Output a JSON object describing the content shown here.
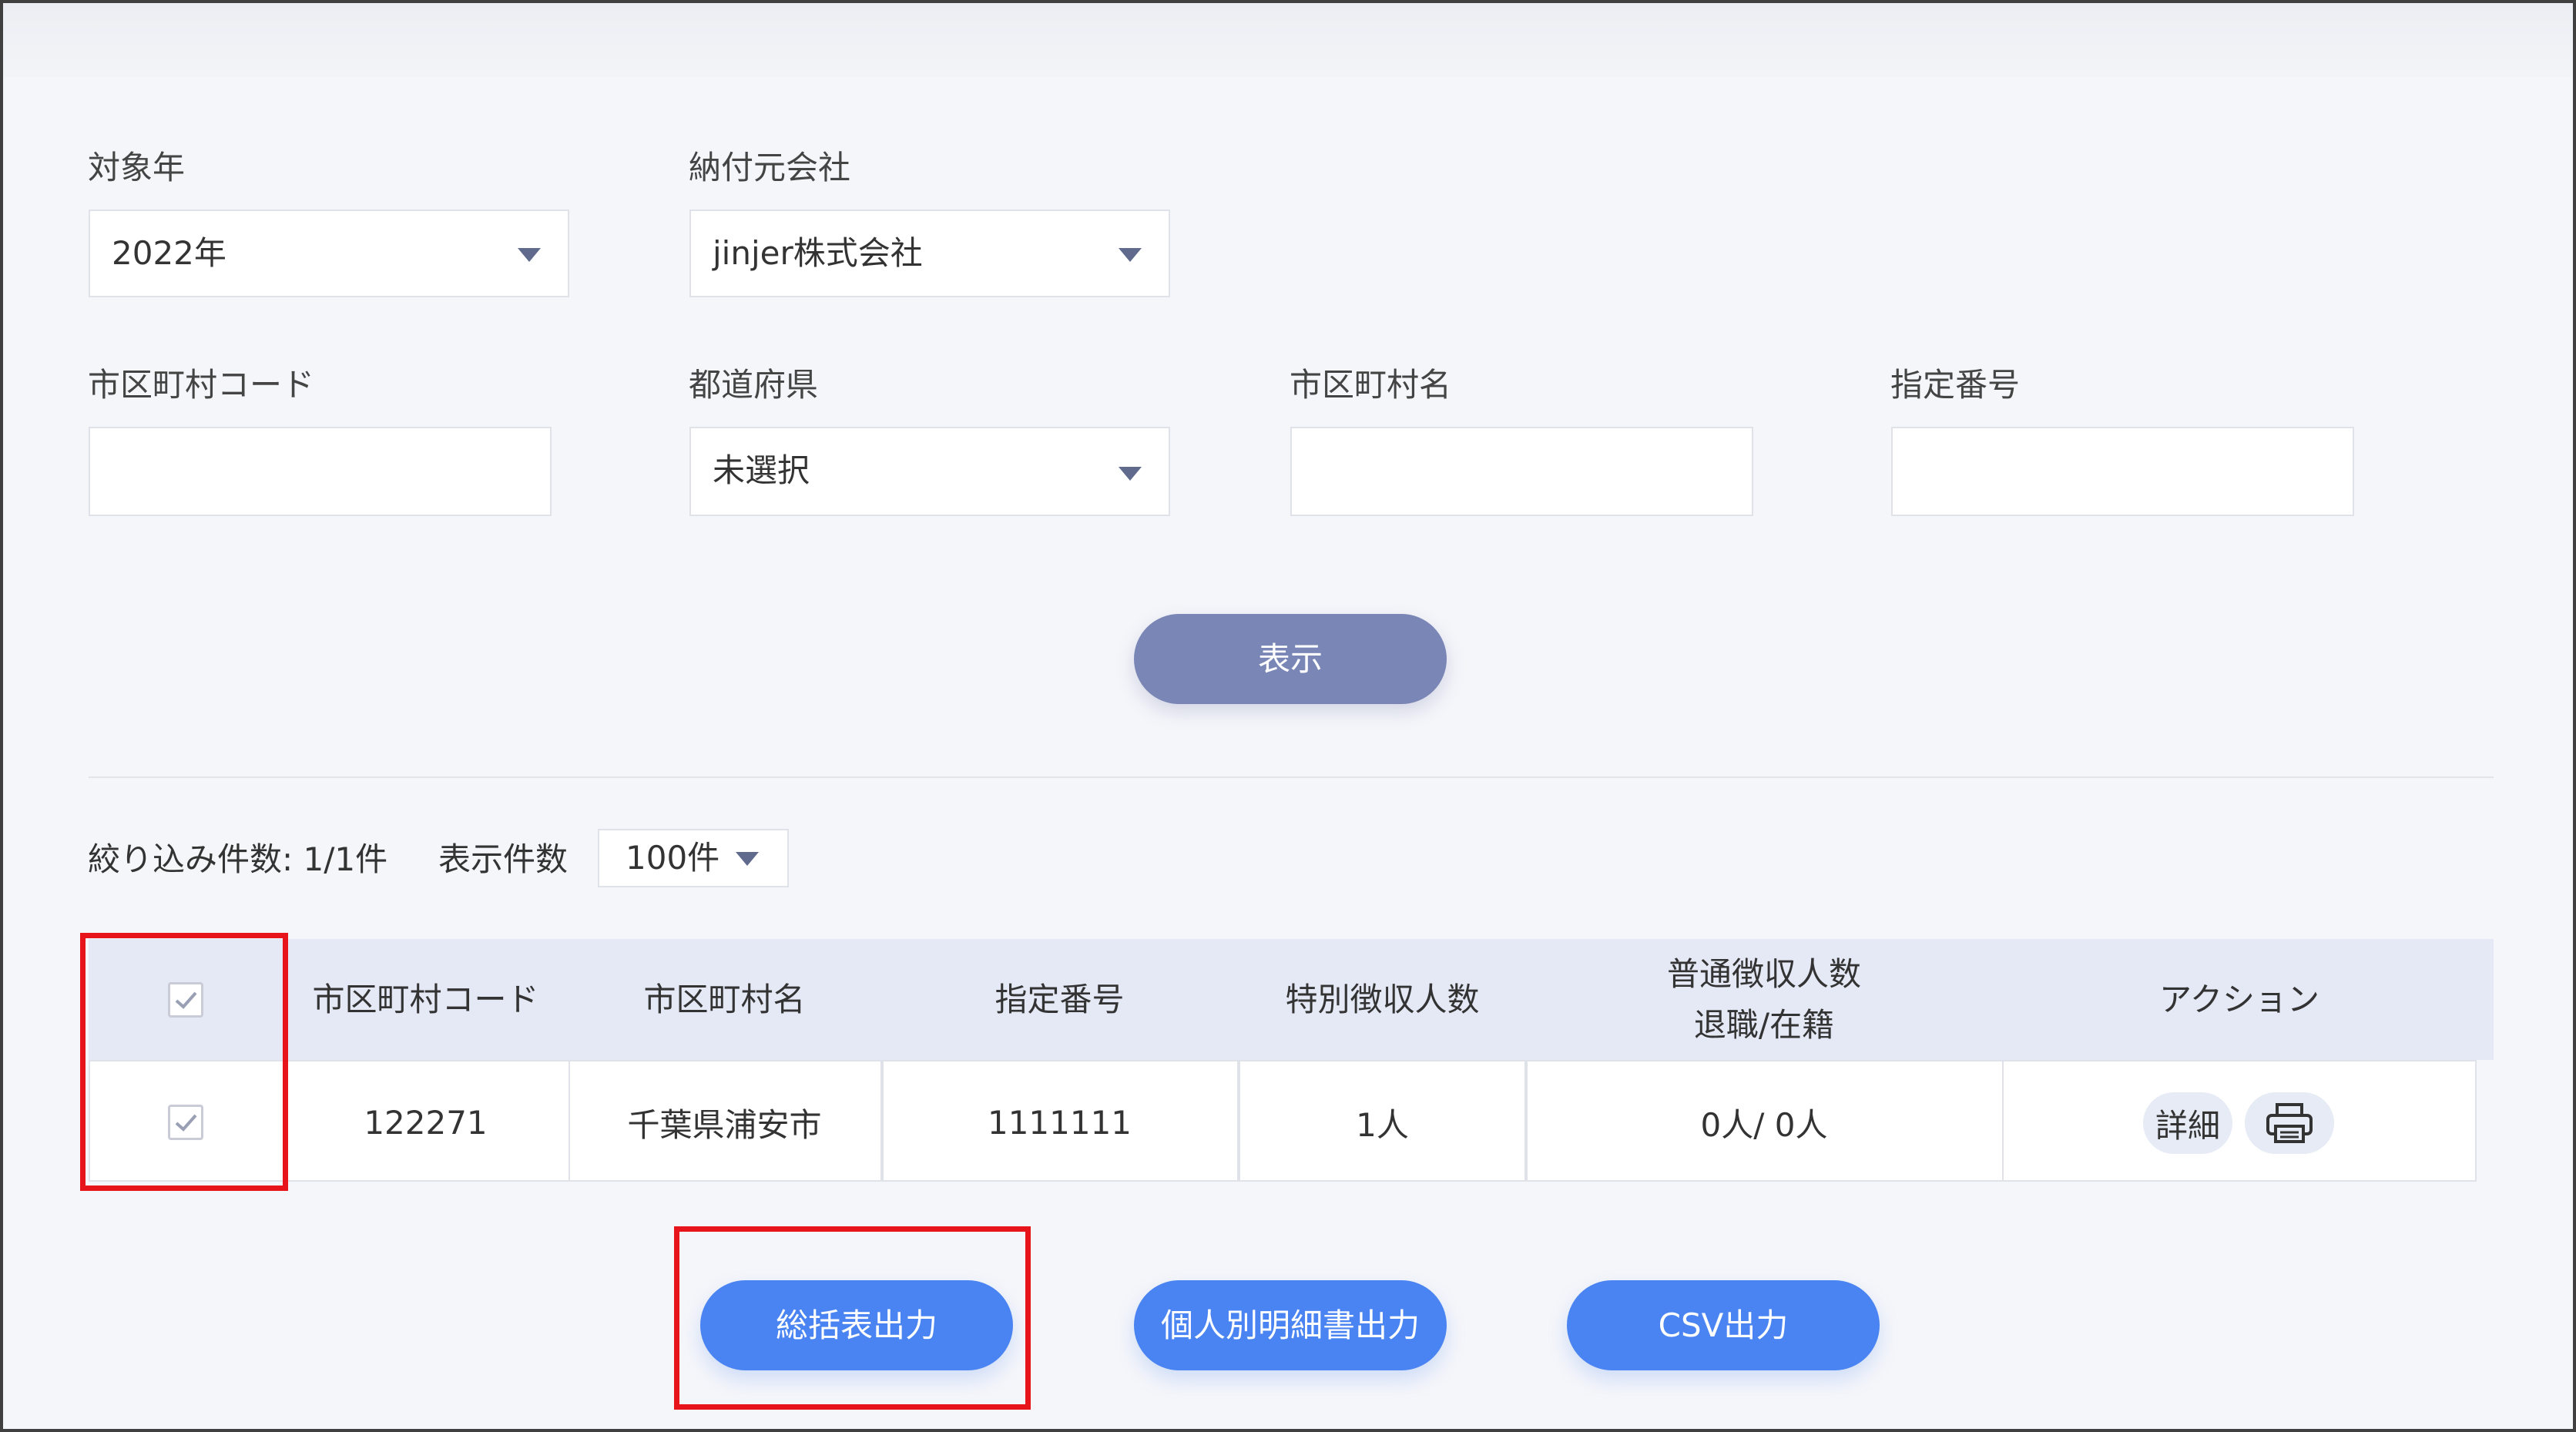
{
  "filters": {
    "year": {
      "label": "対象年",
      "value": "2022年"
    },
    "company": {
      "label": "納付元会社",
      "value": "jinjer株式会社"
    },
    "city_code": {
      "label": "市区町村コード",
      "value": ""
    },
    "prefecture": {
      "label": "都道府県",
      "value": "未選択"
    },
    "city_name": {
      "label": "市区町村名",
      "value": ""
    },
    "designation_no": {
      "label": "指定番号",
      "value": ""
    }
  },
  "display_button": "表示",
  "results": {
    "filter_count": "絞り込み件数: 1/1件",
    "per_page_label": "表示件数",
    "per_page_value": "100件"
  },
  "table": {
    "headers": {
      "code": "市区町村コード",
      "name": "市区町村名",
      "designation": "指定番号",
      "special": "特別徴収人数",
      "normal_line1": "普通徴収人数",
      "normal_line2": "退職/在籍",
      "action": "アクション"
    },
    "rows": [
      {
        "checked": true,
        "code": "122271",
        "name": "千葉県浦安市",
        "designation": "1111111",
        "special": "1人",
        "normal": "0人/ 0人",
        "detail": "詳細"
      }
    ]
  },
  "buttons": {
    "summary": "総括表出力",
    "individual": "個人別明細書出力",
    "csv": "CSV出力"
  },
  "icons": [
    "checkmark-icon",
    "caret-down-icon",
    "printer-icon"
  ],
  "colors": {
    "primary": "#4a84f2",
    "secondary": "#7a86b6",
    "background": "#f5f6fa",
    "highlight": "#e8141b",
    "table_header": "#e4e9f5"
  }
}
